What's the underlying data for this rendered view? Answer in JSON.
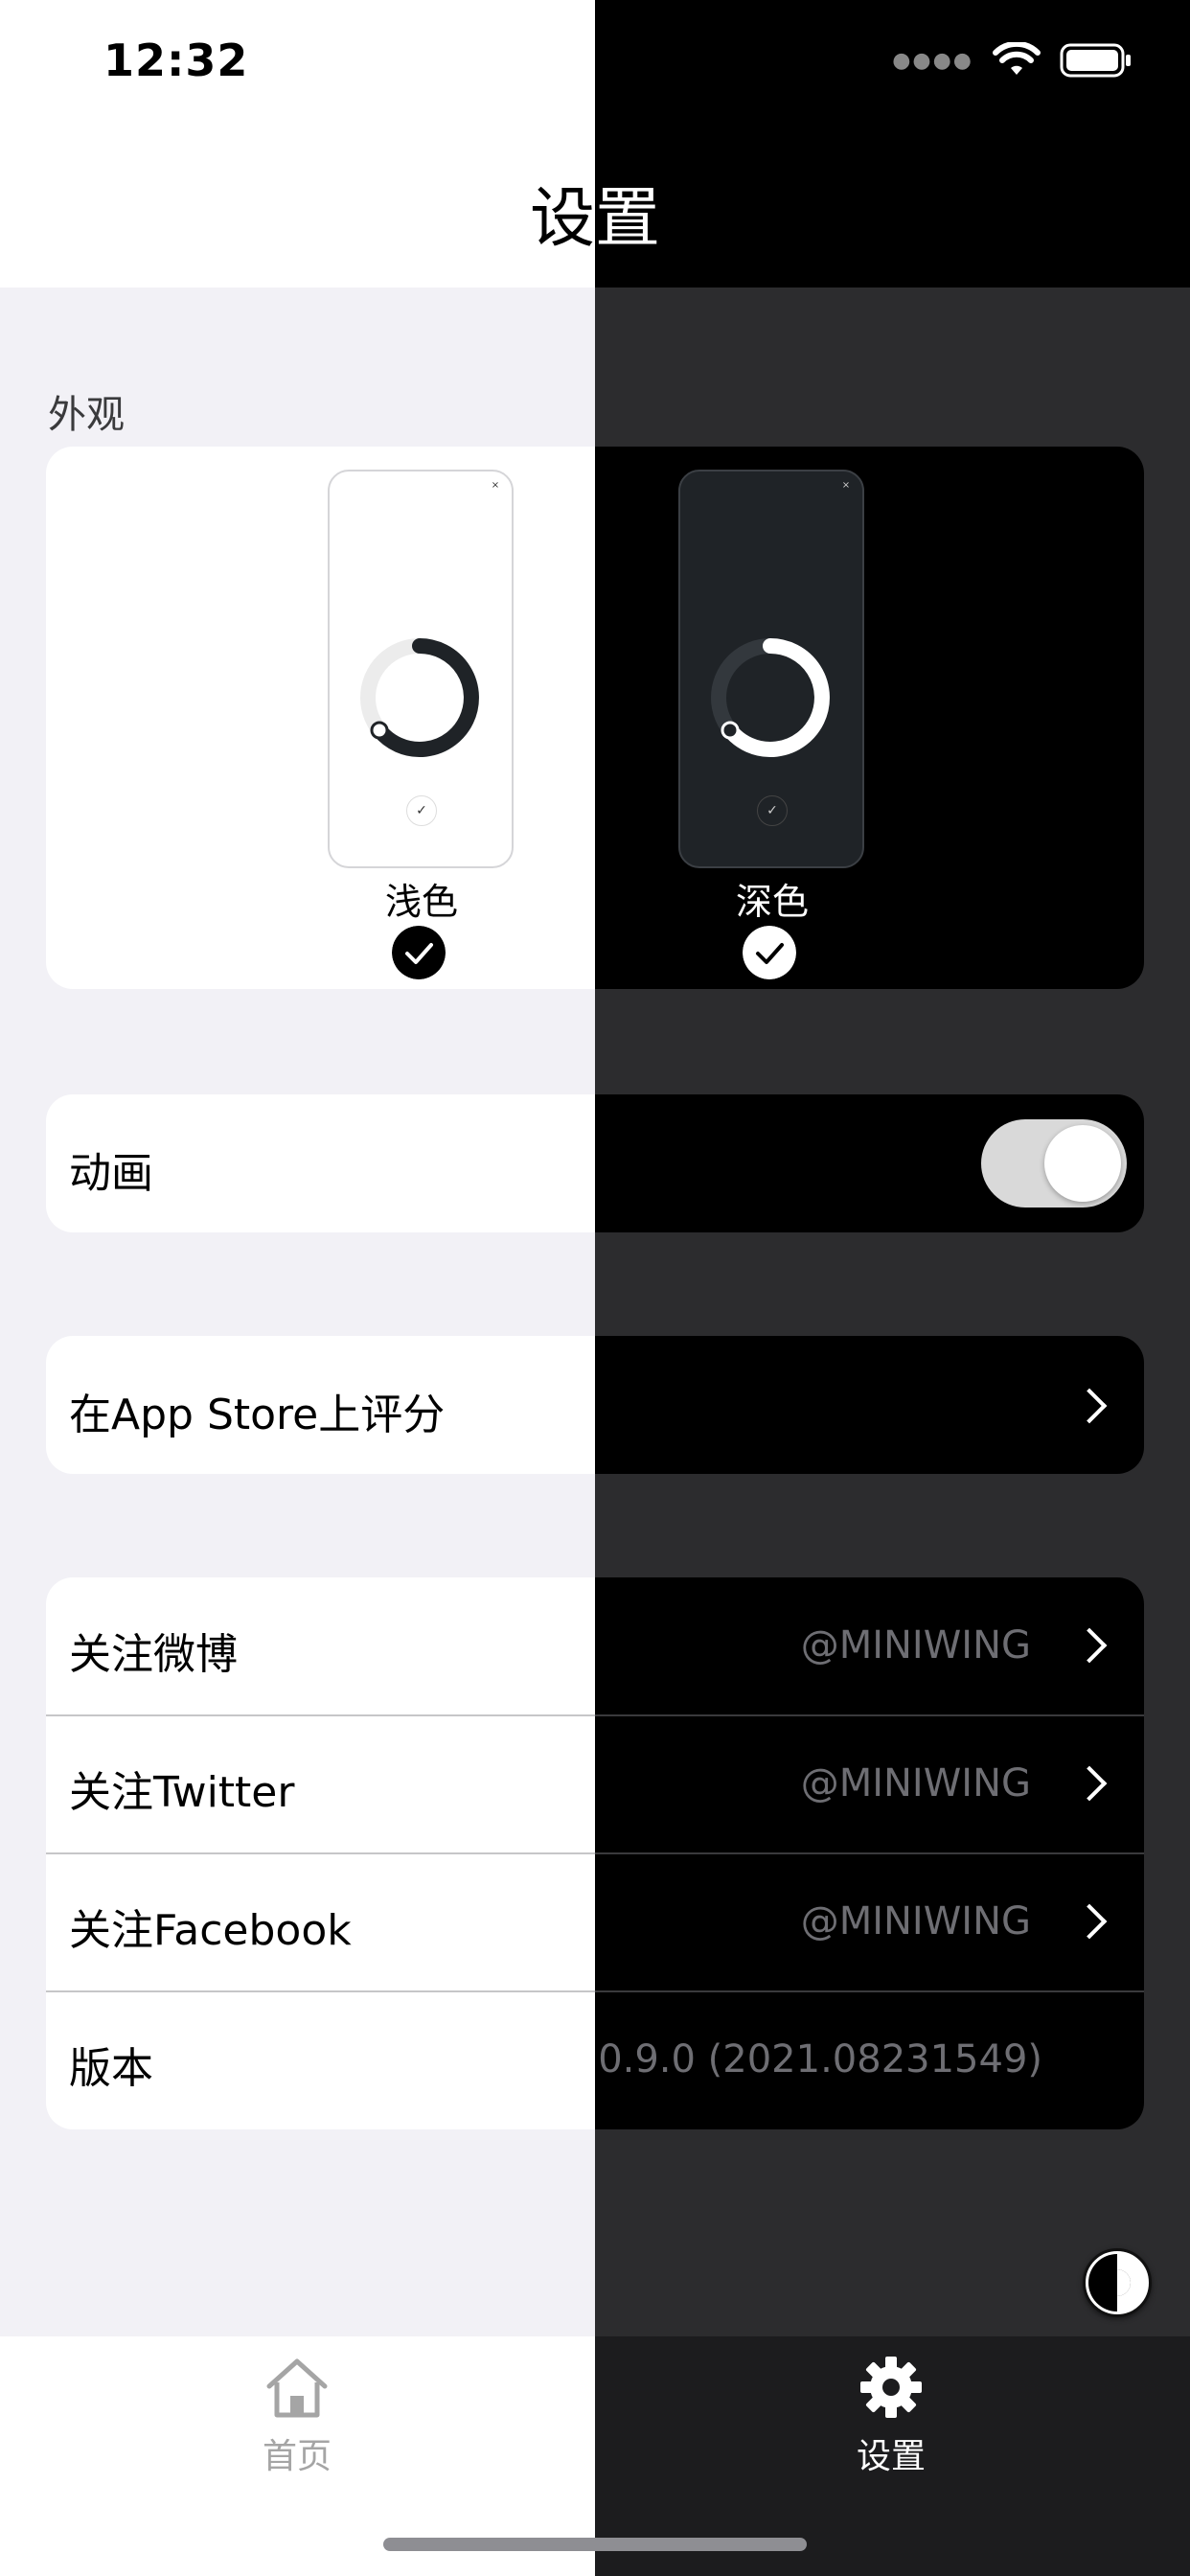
{
  "status_bar": {
    "time": "12:32"
  },
  "header": {
    "title": "设置"
  },
  "appearance": {
    "section_label": "外观",
    "options": [
      {
        "label": "浅色",
        "selected": true
      },
      {
        "label": "深色",
        "selected": true
      }
    ]
  },
  "animation_row": {
    "label": "动画",
    "toggle_on": true
  },
  "rate_row": {
    "label": "在App Store上评分"
  },
  "follow_rows": [
    {
      "label": "关注微博",
      "value": "@MINIWING"
    },
    {
      "label": "关注Twitter",
      "value": "@MINIWING"
    },
    {
      "label": "关注Facebook",
      "value": "@MINIWING"
    },
    {
      "label": "版本",
      "value": "0.9.0 (2021.08231549)"
    }
  ],
  "tab_bar": {
    "items": [
      {
        "label": "首页",
        "icon": "home-icon",
        "active": false
      },
      {
        "label": "设置",
        "icon": "gear-icon",
        "active": true
      }
    ]
  },
  "colors": {
    "light_bg": "#f2f1f6",
    "dark_bg": "#2c2c2e",
    "secondary_text": "#6e6e73"
  }
}
